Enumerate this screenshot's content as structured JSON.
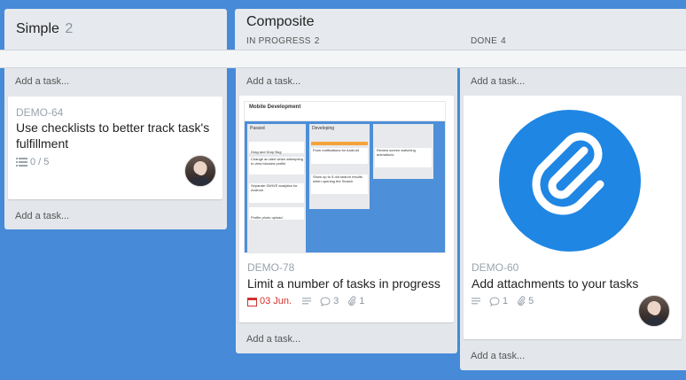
{
  "columns": {
    "simple": {
      "title": "Simple",
      "count": "2",
      "add_top": "Add a task...",
      "add_bottom": "Add a task...",
      "cards": [
        {
          "id": "DEMO-64",
          "title": "Use checklists to better track task's fulfillment",
          "checklist": "0 / 5"
        }
      ]
    },
    "composite": {
      "title": "Composite",
      "in_progress_label": "IN PROGRESS",
      "in_progress_count": "2",
      "done_label": "DONE",
      "done_count": "4"
    },
    "in_progress": {
      "add_top": "Add a task...",
      "add_bottom": "Add a task...",
      "cards": [
        {
          "id": "DEMO-78",
          "title": "Limit a number of tasks in progress",
          "due": "03 Jun.",
          "comments": "3",
          "attachments": "1"
        }
      ],
      "thumbnail": {
        "board_title": "Mobile Development",
        "col1": "Passed",
        "col2": "Developing",
        "c1": "Drag and Drop Bug",
        "c2": "Change an alert when attempting to view blocked profile",
        "c3": "Separate SWIVE analytics for Android",
        "c4": "Profile photo upload",
        "c5": "Push notifications for Android",
        "c6": "Show up to 5 old search results when opening the Search",
        "c7": "Review screen switching animations"
      }
    },
    "done": {
      "add_top": "Add a task...",
      "add_bottom": "Add a task...",
      "cards": [
        {
          "id": "DEMO-60",
          "title": "Add attachments to your tasks",
          "comments": "1",
          "attachments": "5"
        }
      ]
    }
  },
  "colors": {
    "background": "#468ad8",
    "column": "#e3e7eb",
    "due_red": "#d0322f",
    "attach_blue": "#1f86e3"
  }
}
